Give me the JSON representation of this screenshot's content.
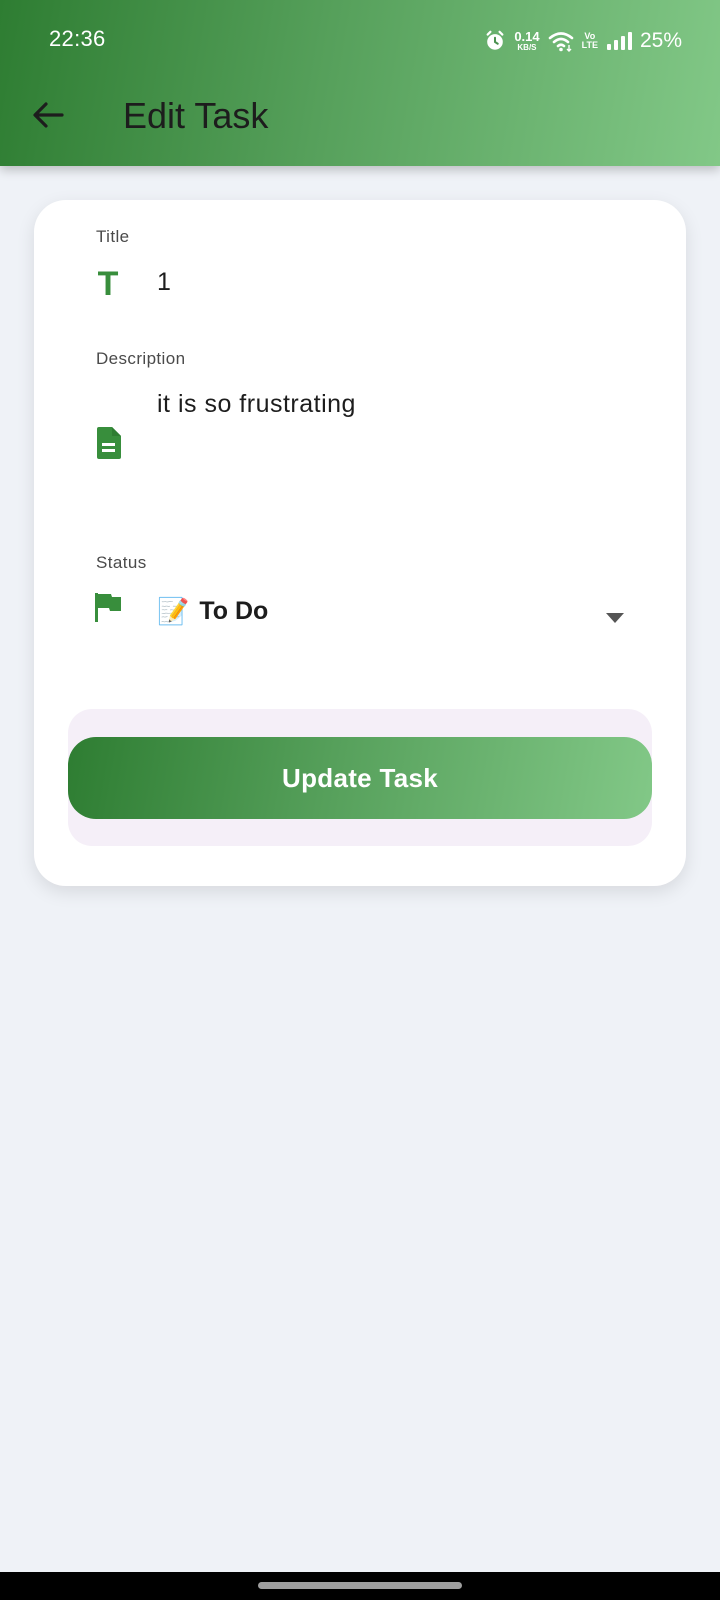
{
  "status_bar": {
    "time": "22:36",
    "net_speed_value": "0.14",
    "net_speed_unit": "KB/S",
    "volte_top": "Vo",
    "volte_bottom": "LTE",
    "battery": "25%"
  },
  "header": {
    "title": "Edit Task",
    "back_icon": "arrow-left-icon"
  },
  "form": {
    "title_label": "Title",
    "title_icon": "title-t-icon",
    "title_value": "1",
    "description_label": "Description",
    "description_icon": "document-icon",
    "description_value": "it is so frustrating",
    "status_label": "Status",
    "status_icon": "flag-icon",
    "status_emoji": "📝",
    "status_value": "To Do",
    "status_dropdown_icon": "dropdown-arrow-icon"
  },
  "actions": {
    "update_label": "Update Task"
  },
  "colors": {
    "accent_dark": "#2e7d32",
    "accent_light": "#82c887",
    "icon_green": "#388e3c",
    "background": "#eff2f7",
    "button_container": "#f5eff8"
  }
}
